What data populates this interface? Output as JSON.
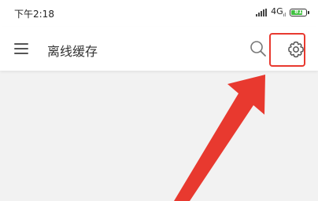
{
  "status_bar": {
    "time": "下午2:18",
    "network": "4G",
    "battery_percent": 81,
    "battery_label": "81"
  },
  "toolbar": {
    "title": "离线缓存",
    "icons": {
      "menu": "menu-icon",
      "search": "search-icon",
      "settings": "gear-icon"
    }
  },
  "colors": {
    "annotation": "#e8392f",
    "battery": "#40c040",
    "background": "#f2f2f2"
  }
}
